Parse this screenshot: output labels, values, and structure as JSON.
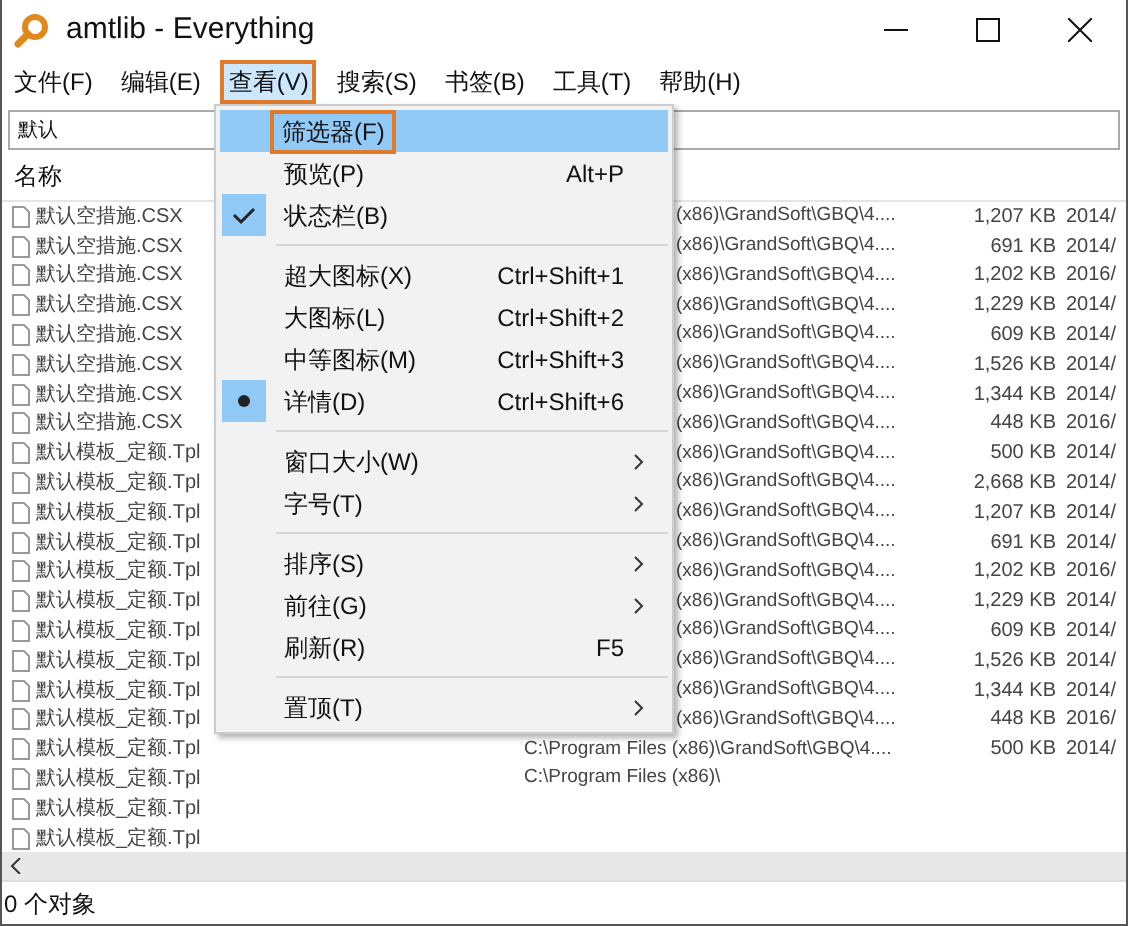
{
  "window": {
    "title": "amtlib - Everything"
  },
  "menubar": [
    {
      "label": "文件(F)",
      "selected": false,
      "annotated": false
    },
    {
      "label": "编辑(E)",
      "selected": false,
      "annotated": false
    },
    {
      "label": "查看(V)",
      "selected": true,
      "annotated": true
    },
    {
      "label": "搜索(S)",
      "selected": false,
      "annotated": false
    },
    {
      "label": "书签(B)",
      "selected": false,
      "annotated": false
    },
    {
      "label": "工具(T)",
      "selected": false,
      "annotated": false
    },
    {
      "label": "帮助(H)",
      "selected": false,
      "annotated": false
    }
  ],
  "search": {
    "value": "默认"
  },
  "table": {
    "columns": [
      "名称"
    ],
    "rows": [
      {
        "name": "默认空措施.CSX",
        "path": "(x86)\\GrandSoft\\GBQ\\4....",
        "path_partly_hidden": true,
        "size": "1,207 KB",
        "date": "2014/"
      },
      {
        "name": "默认空措施.CSX",
        "path": "(x86)\\GrandSoft\\GBQ\\4....",
        "path_partly_hidden": true,
        "size": "691 KB",
        "date": "2014/"
      },
      {
        "name": "默认空措施.CSX",
        "path": "(x86)\\GrandSoft\\GBQ\\4....",
        "path_partly_hidden": true,
        "size": "1,202 KB",
        "date": "2016/"
      },
      {
        "name": "默认空措施.CSX",
        "path": "(x86)\\GrandSoft\\GBQ\\4....",
        "path_partly_hidden": true,
        "size": "1,229 KB",
        "date": "2014/"
      },
      {
        "name": "默认空措施.CSX",
        "path": "(x86)\\GrandSoft\\GBQ\\4....",
        "path_partly_hidden": true,
        "size": "609 KB",
        "date": "2014/"
      },
      {
        "name": "默认空措施.CSX",
        "path": "(x86)\\GrandSoft\\GBQ\\4....",
        "path_partly_hidden": true,
        "size": "1,526 KB",
        "date": "2014/"
      },
      {
        "name": "默认空措施.CSX",
        "path": "(x86)\\GrandSoft\\GBQ\\4....",
        "path_partly_hidden": true,
        "size": "1,344 KB",
        "date": "2014/"
      },
      {
        "name": "默认空措施.CSX",
        "path": "(x86)\\GrandSoft\\GBQ\\4....",
        "path_partly_hidden": true,
        "size": "448 KB",
        "date": "2016/"
      },
      {
        "name": "默认模板_定额.Tpl",
        "path": "(x86)\\GrandSoft\\GBQ\\4....",
        "path_partly_hidden": true,
        "size": "500 KB",
        "date": "2014/"
      },
      {
        "name": "默认模板_定额.Tpl",
        "path": "(x86)\\GrandSoft\\GBQ\\4....",
        "path_partly_hidden": true,
        "size": "2,668 KB",
        "date": "2014/"
      },
      {
        "name": "默认模板_定额.Tpl",
        "path": "(x86)\\GrandSoft\\GBQ\\4....",
        "path_partly_hidden": true,
        "size": "1,207 KB",
        "date": "2014/"
      },
      {
        "name": "默认模板_定额.Tpl",
        "path": "(x86)\\GrandSoft\\GBQ\\4....",
        "path_partly_hidden": true,
        "size": "691 KB",
        "date": "2014/"
      },
      {
        "name": "默认模板_定额.Tpl",
        "path": "(x86)\\GrandSoft\\GBQ\\4....",
        "path_partly_hidden": true,
        "size": "1,202 KB",
        "date": "2016/"
      },
      {
        "name": "默认模板_定额.Tpl",
        "path": "(x86)\\GrandSoft\\GBQ\\4....",
        "path_partly_hidden": true,
        "size": "1,229 KB",
        "date": "2014/"
      },
      {
        "name": "默认模板_定额.Tpl",
        "path": "(x86)\\GrandSoft\\GBQ\\4....",
        "path_partly_hidden": true,
        "size": "609 KB",
        "date": "2014/"
      },
      {
        "name": "默认模板_定额.Tpl",
        "path": "(x86)\\GrandSoft\\GBQ\\4....",
        "path_partly_hidden": true,
        "size": "1,526 KB",
        "date": "2014/"
      },
      {
        "name": "默认模板_定额.Tpl",
        "path": "(x86)\\GrandSoft\\GBQ\\4....",
        "path_partly_hidden": true,
        "size": "1,344 KB",
        "date": "2014/"
      },
      {
        "name": "默认模板_定额.Tpl",
        "path": "(x86)\\GrandSoft\\GBQ\\4....",
        "path_partly_hidden": true,
        "size": "448 KB",
        "date": "2016/"
      },
      {
        "name": "默认模板_定额.Tpl",
        "path": "C:\\Program Files (x86)\\GrandSoft\\GBQ\\4....",
        "path_partly_hidden": false,
        "size": "500 KB",
        "date": "2014/"
      },
      {
        "name": "默认模板_定额.Tpl",
        "path": "C:\\Program Files (x86)\\",
        "path_partly_hidden": false
      },
      {
        "name": "默认模板_定额.Tpl"
      },
      {
        "name": "默认模板_定额.Tpl"
      }
    ]
  },
  "menu": [
    {
      "kind": "item",
      "label": "筛选器(F)",
      "selected": true,
      "annotated": true
    },
    {
      "kind": "item",
      "label": "预览(P)",
      "shortcut": "Alt+P",
      "selected": false,
      "annotated": false
    },
    {
      "kind": "item",
      "label": "状态栏(B)",
      "checked": true,
      "selected": false,
      "annotated": false
    },
    {
      "kind": "separator"
    },
    {
      "kind": "item",
      "label": "超大图标(X)",
      "shortcut": "Ctrl+Shift+1",
      "selected": false,
      "annotated": false
    },
    {
      "kind": "item",
      "label": "大图标(L)",
      "shortcut": "Ctrl+Shift+2",
      "selected": false,
      "annotated": false
    },
    {
      "kind": "item",
      "label": "中等图标(M)",
      "shortcut": "Ctrl+Shift+3",
      "selected": false,
      "annotated": false
    },
    {
      "kind": "radio",
      "label": "详情(D)",
      "shortcut": "Ctrl+Shift+6",
      "checked": true,
      "selected": false,
      "annotated": false
    },
    {
      "kind": "separator"
    },
    {
      "kind": "item",
      "label": "窗口大小(W)",
      "submenu": true,
      "selected": false,
      "annotated": false
    },
    {
      "kind": "item",
      "label": "字号(T)",
      "submenu": true,
      "selected": false,
      "annotated": false
    },
    {
      "kind": "separator"
    },
    {
      "kind": "item",
      "label": "排序(S)",
      "submenu": true,
      "selected": false,
      "annotated": false
    },
    {
      "kind": "item",
      "label": "前往(G)",
      "submenu": true,
      "selected": false,
      "annotated": false
    },
    {
      "kind": "item",
      "label": "刷新(R)",
      "shortcut": "F5",
      "selected": false,
      "annotated": false
    },
    {
      "kind": "separator"
    },
    {
      "kind": "item",
      "label": "置顶(T)",
      "submenu": true,
      "selected": false,
      "annotated": false
    }
  ],
  "status_bar": {
    "text": "0 个对象"
  }
}
